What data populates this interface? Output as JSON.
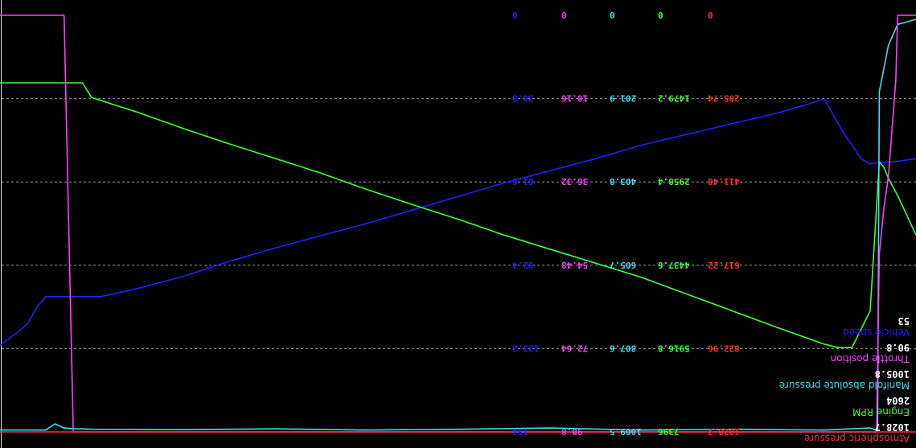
{
  "chart_data": {
    "type": "line",
    "orientation": "rotated-180",
    "grid": true,
    "cursor_x": 100,
    "colors": {
      "Atmospheric pressure": "#ff3030",
      "Engine RPM": "#3cff3c",
      "Manifold absolute pressure": "#40e0f0",
      "Throttle position": "#ff40ff",
      "Vehicle speed": "#2020ff"
    },
    "axes": [
      {
        "series": "Atmospheric pressure",
        "ticks": [
          "1028.7",
          "822.96",
          "617.22",
          "411.48",
          "205.74",
          "0"
        ]
      },
      {
        "series": "Engine RPM",
        "ticks": [
          "7396",
          "5916.8",
          "4437.6",
          "2958.4",
          "1479.2",
          "0"
        ]
      },
      {
        "series": "Manifold absolute pressure",
        "ticks": [
          "1009.5",
          "807.6",
          "605.7",
          "403.8",
          "201.9",
          "0"
        ]
      },
      {
        "series": "Throttle position",
        "ticks": [
          "90.8",
          "72.64",
          "54.48",
          "36.32",
          "18.16",
          "0"
        ]
      },
      {
        "series": "Vehicle speed",
        "ticks": [
          "154",
          "123.2",
          "92.4",
          "61.6",
          "30.8",
          "0"
        ]
      }
    ],
    "legend": {
      "placement": "top-left",
      "items": [
        {
          "name": "Atmospheric pressure",
          "value": "1028.7"
        },
        {
          "name": "Engine RPM",
          "value": "2604"
        },
        {
          "name": "Manifold absolute pressure",
          "value": "1005.8"
        },
        {
          "name": "Throttle position",
          "value": "90.8"
        },
        {
          "name": "Vehicle speed",
          "value": "53"
        }
      ]
    },
    "series": [
      {
        "name": "Vehicle speed",
        "ymax": 154,
        "x": [
          0,
          2,
          4,
          5,
          6,
          8,
          10,
          15,
          20,
          25,
          30,
          35,
          40,
          45,
          50,
          55,
          60,
          65,
          70,
          75,
          80,
          85,
          89,
          90,
          92,
          93,
          94,
          95,
          96,
          97,
          98,
          100
        ],
        "y": [
          53,
          54,
          54.5,
          55,
          53,
          43,
          31,
          36,
          40,
          44,
          48,
          53,
          57.5,
          62,
          67,
          72,
          77,
          81.5,
          86,
          91,
          96.5,
          101,
          104,
          104,
          104,
          104,
          104,
          104,
          108,
          114,
          117,
          122
        ]
      },
      {
        "name": "Engine RPM",
        "ymax": 7396,
        "x": [
          0,
          2,
          3,
          3.5,
          4,
          5,
          7,
          8.5,
          10,
          15,
          20,
          25,
          30,
          35,
          40,
          45,
          50,
          55,
          60,
          65,
          70,
          75,
          80,
          85,
          90,
          91,
          92,
          100
        ],
        "y": [
          3900,
          3200,
          2900,
          2700,
          2604,
          5250,
          5900,
          5900,
          5840,
          5550,
          5250,
          4950,
          4650,
          4400,
          4150,
          3900,
          3620,
          3360,
          3090,
          2800,
          2540,
          2280,
          2010,
          1720,
          1460,
          1200,
          1200,
          1200
        ]
      },
      {
        "name": "Manifold absolute pressure",
        "ymax": 1009.5,
        "x": [
          0,
          2,
          3,
          4,
          4.2,
          5,
          10,
          20,
          30,
          40,
          50,
          60,
          70,
          80,
          90,
          91,
          92,
          93,
          94,
          95,
          100
        ],
        "y": [
          10,
          22,
          72,
          185,
          1005.8,
          1000,
          1005,
          1003,
          1005,
          1000,
          1003,
          1005,
          1002,
          1004,
          1003,
          1002,
          1002,
          1000,
          990,
          1005,
          1005
        ]
      },
      {
        "name": "Throttle position",
        "ymax": 90.8,
        "x": [
          0,
          2,
          2.2,
          3,
          3.5,
          4,
          4.3,
          5,
          92,
          93,
          100
        ],
        "y": [
          0,
          0,
          14,
          35,
          42,
          52,
          90.8,
          90.8,
          90.8,
          0,
          0
        ]
      },
      {
        "name": "Atmospheric pressure",
        "ymax": 1028.7,
        "x": [
          0,
          100
        ],
        "y": [
          1028.7,
          1028.7
        ]
      }
    ]
  }
}
